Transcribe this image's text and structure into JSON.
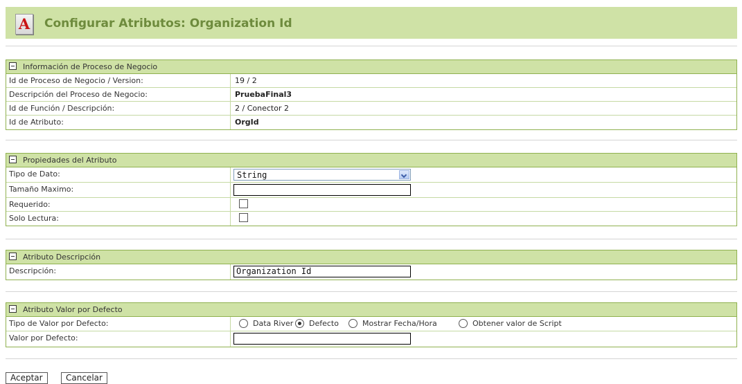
{
  "header": {
    "logo_letter": "A",
    "title": "Configurar Atributos: Organization Id"
  },
  "process_info": {
    "title": "Información de Proceso de Negocio",
    "rows": [
      {
        "label": "Id de Proceso de Negocio / Version:",
        "value": "19 / 2"
      },
      {
        "label": "Descripción del Proceso de Negocio:",
        "value": "PruebaFinal3"
      },
      {
        "label": "Id de Función / Descripción:",
        "value": "2 / Conector 2"
      },
      {
        "label": "Id de Atributo:",
        "value": "OrgId"
      }
    ]
  },
  "properties": {
    "title": "Propiedades del Atributo",
    "data_type_label": "Tipo de Dato:",
    "data_type_value": "String",
    "max_size_label": "Tamaño Maximo:",
    "max_size_value": "",
    "required_label": "Requerido:",
    "required_checked": false,
    "readonly_label": "Solo Lectura:",
    "readonly_checked": false
  },
  "description": {
    "title": "Atributo Descripción",
    "label": "Descripción:",
    "value": "Organization Id"
  },
  "default_value": {
    "title": "Atributo Valor por Defecto",
    "type_label": "Tipo de Valor por Defecto:",
    "options": [
      {
        "label": "Data River",
        "checked": false
      },
      {
        "label": "Defecto",
        "checked": true
      },
      {
        "label": "Mostrar Fecha/Hora",
        "checked": false
      },
      {
        "label": "Obtener valor de Script",
        "checked": false
      }
    ],
    "value_label": "Valor por Defecto:",
    "value": ""
  },
  "buttons": {
    "accept": "Aceptar",
    "cancel": "Cancelar"
  },
  "colors": {
    "panel_header": "#cfe2a6",
    "border": "#8fb14f",
    "title_green": "#6e8b3d",
    "logo_red": "#c81414"
  }
}
